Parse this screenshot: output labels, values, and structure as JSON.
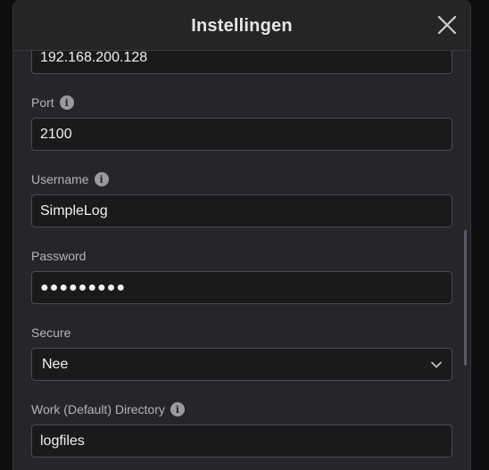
{
  "dialog": {
    "title": "Instellingen"
  },
  "fields": {
    "host": {
      "value": "192.168.200.128"
    },
    "port": {
      "label": "Port",
      "value": "2100"
    },
    "username": {
      "label": "Username",
      "value": "SimpleLog"
    },
    "password": {
      "label": "Password",
      "value": "●●●●●●●●●"
    },
    "secure": {
      "label": "Secure",
      "value": "Nee"
    },
    "work_directory": {
      "label": "Work (Default) Directory",
      "value": "logfiles"
    }
  },
  "icons": {
    "info": "i"
  },
  "colors": {
    "background": "#26262a",
    "input_background": "#1a1a1d",
    "input_border": "#4a4a50",
    "text": "#f0f0f0",
    "label": "#b4b4b8"
  }
}
